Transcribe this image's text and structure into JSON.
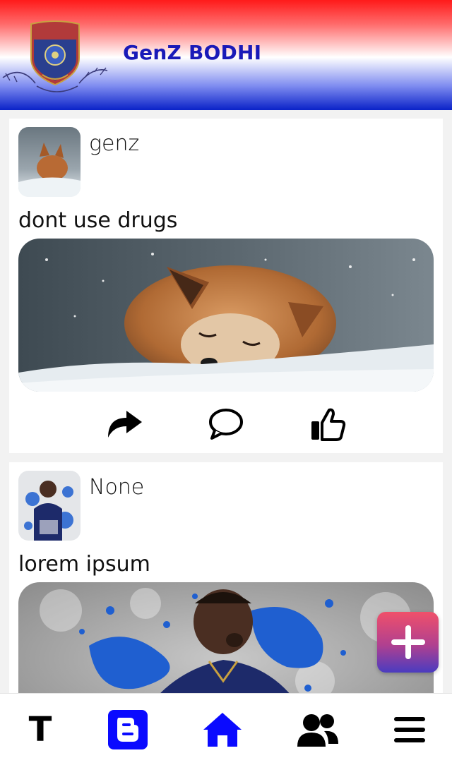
{
  "header": {
    "brand": "GenZ BODHI",
    "emblem_icon": "narcotics-bureau-emblem-icon",
    "colors": {
      "top": "#ff1a1a",
      "bottom": "#0a22c8",
      "brand_text": "#1a1ab8"
    }
  },
  "feed": {
    "posts": [
      {
        "username": "genz",
        "text": "dont use drugs",
        "avatar_icon": "fox-avatar",
        "image_icon": "sleeping-fox-in-snow-photo"
      },
      {
        "username": "None",
        "text": "lorem ipsum",
        "avatar_icon": "football-player-avatar",
        "image_icon": "football-player-paint-splash-photo"
      }
    ],
    "actions": {
      "share_icon": "share-icon",
      "comment_icon": "comment-icon",
      "like_icon": "thumbs-up-icon"
    }
  },
  "fab": {
    "icon": "plus-icon",
    "colors": [
      "#f0506a",
      "#4a3cc0"
    ]
  },
  "bottom_nav": {
    "items": [
      {
        "label": "T",
        "icon": "text-icon"
      },
      {
        "icon": "blogger-icon",
        "color": "#0a0aff"
      },
      {
        "icon": "home-icon",
        "color": "#0a0aff"
      },
      {
        "icon": "users-icon",
        "color": "#000000"
      },
      {
        "icon": "menu-icon",
        "color": "#000000"
      }
    ]
  }
}
